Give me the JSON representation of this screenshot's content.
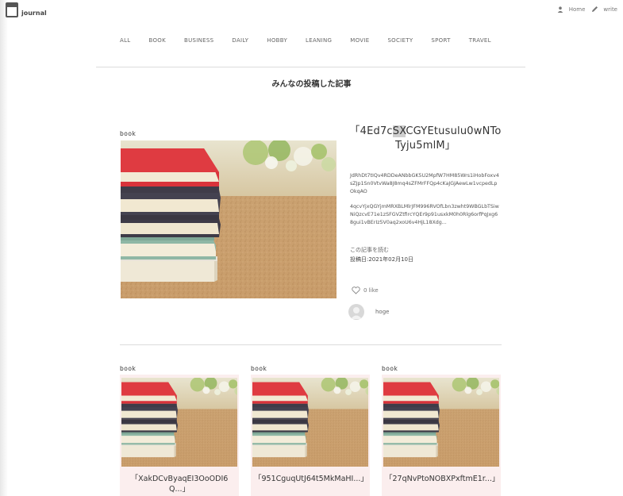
{
  "header": {
    "logo_text": "journal",
    "home_label": "Home",
    "write_label": "write"
  },
  "nav": {
    "items": [
      "ALL",
      "BOOK",
      "BUSINESS",
      "DAILY",
      "HOBBY",
      "LEANING",
      "MOVIE",
      "SOCIETY",
      "SPORT",
      "TRAVEL"
    ]
  },
  "page_title": "みんなの投稿した記事",
  "featured": {
    "category": "book",
    "title_pre": "「4Ed7c",
    "title_hl": "SX",
    "title_post": "CGYEtusulu0wNToTyju5mlM」",
    "body_p1": "JdRhDt7tIQv4RDDeANbbGK5U2MpfW7HM85Wrs1iHobFoxv4sZJp1Sn0VtvWa8J8mq4sZFMrFFQp4cKaJGJAewLw1vcpedLpOkqAO",
    "body_p2": "4qcvYjxQGYjmMRXBLMlrJFM996RVOfLbn3zwht9WBGLbTSiwNiQzcvE71e1zSFGVZtfircYQEr9p91usxkM0h0Rlg6orfPqJxg68gui1vBErIz5V0aq2xoU6v4HjL18Xdg...",
    "read_more": "この記事を読む",
    "date": "投稿日:2021年02月10日",
    "likes": "0 like",
    "author": "hoge"
  },
  "cards": [
    {
      "category": "book",
      "title": "「XakDCvByaqEI3OoODI6Q...」"
    },
    {
      "category": "book",
      "title": "「951CguqUtJ64t5MkMaHI...」"
    },
    {
      "category": "book",
      "title": "「27qNvPtoNOBXPxftmE1r...」"
    }
  ],
  "colors": {
    "card_background": "#fbeeee",
    "book_red": "#d9333b",
    "book_dark": "#3f3b47",
    "book_green": "#7fa896"
  },
  "icons": {
    "home": "person-icon",
    "write": "pencil-icon",
    "like": "heart-icon"
  }
}
